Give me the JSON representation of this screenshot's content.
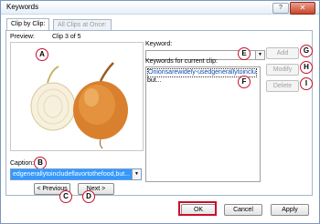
{
  "window": {
    "title": "Keywords",
    "help": "?",
    "close": "✕"
  },
  "tabs": [
    {
      "label": "Clip by Clip:",
      "active": true
    },
    {
      "label": "All Clips at Once:",
      "active": false
    }
  ],
  "preview": {
    "label": "Preview:",
    "counter": "Clip 3 of 5"
  },
  "caption": {
    "label": "Caption:",
    "value": "edgenerallytoincludeflavortothefood,but..."
  },
  "nav": {
    "previous": "< Previous",
    "next": "Next >"
  },
  "keyword": {
    "label": "Keyword:",
    "value": ""
  },
  "keywords_list": {
    "label": "Keywords for current clip:",
    "items": [
      "Onionsarewidely-usedgenerallytoinclud",
      "but..."
    ]
  },
  "side_buttons": {
    "add": "Add",
    "modify": "Modify",
    "delete": "Delete"
  },
  "footer": {
    "ok": "OK",
    "cancel": "Cancel",
    "apply": "Apply"
  },
  "callouts": [
    "A",
    "B",
    "C",
    "D",
    "E",
    "F",
    "G",
    "H",
    "I"
  ],
  "colors": {
    "highlight": "#c8102e",
    "selection": "#3399ff"
  }
}
